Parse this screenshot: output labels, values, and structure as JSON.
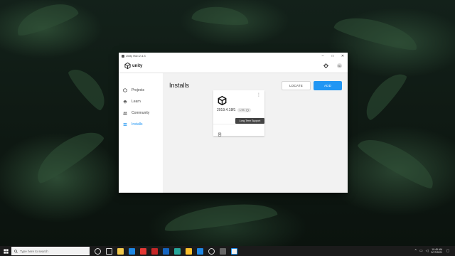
{
  "window": {
    "title": "Unity Hub 2.4.3",
    "controls": {
      "minimize": "–",
      "maximize": "□",
      "close": "✕"
    }
  },
  "header": {
    "logo_text": "unity",
    "settings_icon": "gear-icon",
    "avatar_text": "SD"
  },
  "sidebar": {
    "items": [
      {
        "label": "Projects",
        "icon": "projects-icon",
        "active": false
      },
      {
        "label": "Learn",
        "icon": "learn-icon",
        "active": false
      },
      {
        "label": "Community",
        "icon": "community-icon",
        "active": false
      },
      {
        "label": "Installs",
        "icon": "installs-icon",
        "active": true
      }
    ]
  },
  "main": {
    "title": "Installs",
    "locate_label": "LOCATE",
    "add_label": "ADD"
  },
  "install_card": {
    "version": "2019.4.18f1",
    "badge": "LTS",
    "tooltip": "Long Term Support",
    "menu_icon": "more-vertical-icon",
    "footer_icon": "platform-icon"
  },
  "taskbar": {
    "search_placeholder": "Type here to search",
    "time": "10:45 AM",
    "date": "3/17/2021"
  },
  "colors": {
    "accent": "#2196f3",
    "main_bg": "#f2f2f2",
    "taskbar": "#1b1b1b"
  }
}
